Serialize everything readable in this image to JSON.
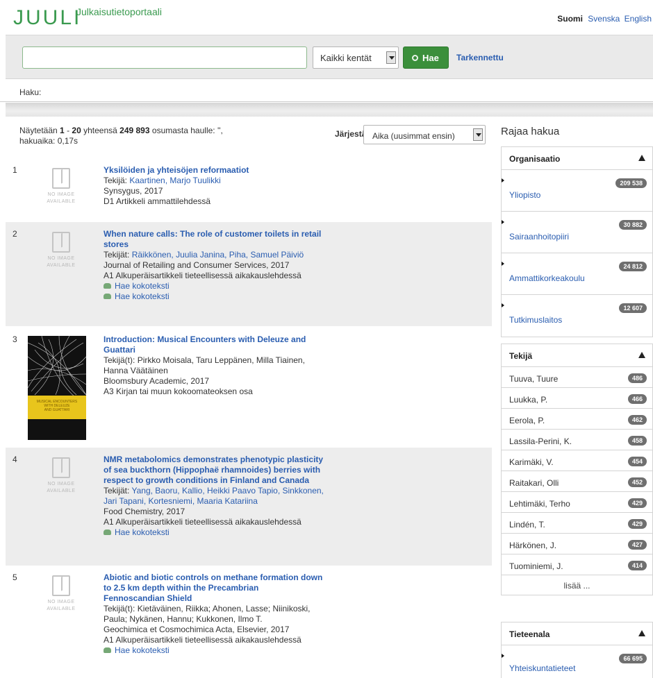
{
  "header": {
    "logo": "JUULI",
    "subtitle": "Julkaisutietoportaali",
    "languages": {
      "current": "Suomi",
      "others": [
        "Svenska",
        "English"
      ]
    }
  },
  "search": {
    "query_value": "",
    "field_selected": "Kaikki kentät",
    "submit_label": "Hae",
    "advanced_label": "Tarkennettu",
    "haku_label": "Haku:"
  },
  "results_header": {
    "prefix": "Näytetään",
    "from": "1",
    "dash": " - ",
    "to": "20",
    "mid": "yhteensä",
    "total": "249 893",
    "suffix": "osumasta haulle: '',",
    "time": "hakuaika: 0,17s",
    "sort_label": "Järjestä",
    "sort_selected": "Aika (uusimmat ensin)"
  },
  "no_image_text": [
    "NO IMAGE",
    "AVAILABLE"
  ],
  "fulltext_label": "Hae kokoteksti",
  "results": [
    {
      "num": "1",
      "title_lines": [
        "Yksilöiden ja yhteisöjen reformaatiot"
      ],
      "author_prefix": "Tekijä:",
      "authors_lines": [
        "Kaartinen, Marjo Tuulikki"
      ],
      "source": "Synsygus, 2017",
      "type": "D1 Artikkeli ammattilehdessä"
    },
    {
      "num": "2",
      "title_lines": [
        "When nature calls: The role of customer toilets in retail",
        "stores"
      ],
      "author_prefix": "Tekijät:",
      "authors_lines": [
        "Räikkönen, Juulia Janina, Piha, Samuel Päiviö"
      ],
      "source": "Journal of Retailing and Consumer Services, 2017",
      "type": "A1 Alkuperäisartikkeli tieteellisessä aikakauslehdessä"
    },
    {
      "num": "3",
      "title_lines": [
        "Introduction: Musical Encounters with Deleuze and",
        "Guattari"
      ],
      "author_prefix": "Tekijä(t):",
      "authors_lines": [
        "Pirkko Moisala, Taru Leppänen, Milla Tiainen,",
        "Hanna Väätäinen"
      ],
      "source": "Bloomsbury Academic, 2017",
      "type": "A3 Kirjan tai muun kokoomateoksen osa",
      "cover_text": [
        "MUSICAL ENCOUNTERS",
        "WITH DELEUZE",
        "AND GUATTARI"
      ]
    },
    {
      "num": "4",
      "title_lines": [
        "NMR metabolomics demonstrates phenotypic plasticity",
        "of sea buckthorn (Hippophaë rhamnoides) berries with",
        "respect to growth conditions in Finland and Canada"
      ],
      "author_prefix": "Tekijät:",
      "authors_lines": [
        "Yang, Baoru, Kallio, Heikki Paavo Tapio, Sinkkonen,",
        "Jari Tapani, Kortesniemi, Maaria Katariina"
      ],
      "source": "Food Chemistry, 2017",
      "type": "A1 Alkuperäisartikkeli tieteellisessä aikakauslehdessä"
    },
    {
      "num": "5",
      "title_lines": [
        "Abiotic and biotic controls on methane formation down",
        "to 2.5 km depth within the Precambrian",
        "Fennoscandian Shield"
      ],
      "author_prefix": "Tekijä(t):",
      "authors_lines": [
        "Kietäväinen, Riikka; Ahonen, Lasse; Niinikoski,",
        "Paula; Nykänen, Hannu; Kukkonen, Ilmo T."
      ],
      "source": "Geochimica et Cosmochimica Acta, Elsevier, 2017",
      "type": "A1 Alkuperäisartikkeli tieteellisessä aikakauslehdessä"
    }
  ],
  "sidebar": {
    "title": "Rajaa hakua",
    "organisaatio": {
      "heading": "Organisaatio",
      "items": [
        {
          "label": "Yliopisto",
          "count": "209 538"
        },
        {
          "label": "Sairaanhoitopiiri",
          "count": "30 882"
        },
        {
          "label": "Ammattikorkeakoulu",
          "count": "24 812"
        },
        {
          "label": "Tutkimuslaitos",
          "count": "12 607"
        }
      ]
    },
    "tekija": {
      "heading": "Tekijä",
      "items": [
        {
          "label": "Tuuva, Tuure",
          "count": "486"
        },
        {
          "label": "Luukka, P.",
          "count": "466"
        },
        {
          "label": "Eerola, P.",
          "count": "462"
        },
        {
          "label": "Lassila-Perini, K.",
          "count": "458"
        },
        {
          "label": "Karimäki, V.",
          "count": "454"
        },
        {
          "label": "Raitakari, Olli",
          "count": "452"
        },
        {
          "label": "Lehtimäki, Terho",
          "count": "429"
        },
        {
          "label": "Lindén, T.",
          "count": "429"
        },
        {
          "label": "Härkönen, J.",
          "count": "427"
        },
        {
          "label": "Tuominiemi, J.",
          "count": "414"
        }
      ],
      "more_label": "lisää ..."
    },
    "tieteenala": {
      "heading": "Tieteenala",
      "items": [
        {
          "label": "Yhteiskuntatieteet",
          "count": "66 695"
        }
      ]
    }
  }
}
